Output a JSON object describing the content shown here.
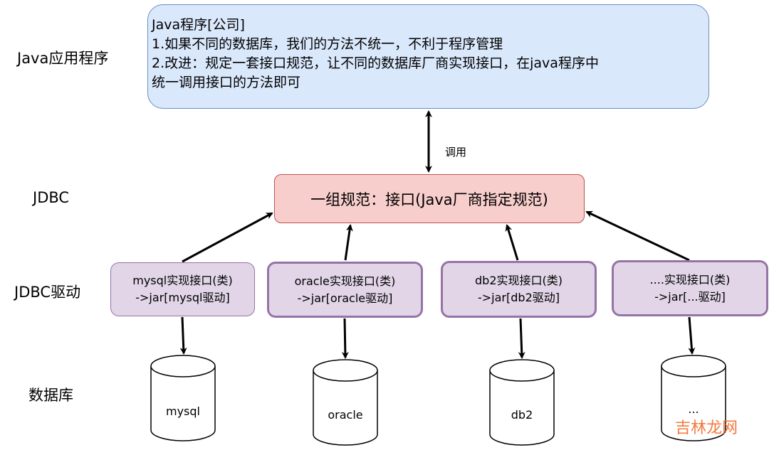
{
  "side_labels": {
    "app": "Java应用程序",
    "jdbc": "JDBC",
    "driver": "JDBC驱动",
    "db": "数据库"
  },
  "app_box": {
    "lines": [
      "Java程序[公司]",
      "1.如果不同的数据库，我们的方法不统一，不利于程序管理",
      "2.改进：规定一套接口规范，让不同的数据库厂商实现接口，在java程序中",
      "统一调用接口的方法即可"
    ]
  },
  "call_label": "调用",
  "jdbc_box": "一组规范：接口(Java厂商指定规范)",
  "drivers": [
    {
      "line1": "mysql实现接口(类)",
      "line2": "->jar[mysql驱动]"
    },
    {
      "line1": "oracle实现接口(类)",
      "line2": "->jar[oracle驱动]"
    },
    {
      "line1": "db2实现接口(类)",
      "line2": "->jar[db2驱动]"
    },
    {
      "line1": "....实现接口(类)",
      "line2": "->jar[...驱动]"
    }
  ],
  "databases": [
    "mysql",
    "oracle",
    "db2",
    "..."
  ],
  "watermark": "吉林龙网",
  "colors": {
    "app_fill": "#dae8fc",
    "app_stroke": "#6c8ebf",
    "jdbc_fill": "#f8cecc",
    "jdbc_stroke": "#b85450",
    "driver_fill": "#e1d5e7",
    "driver_stroke": "#9673a6",
    "watermark": "#f26b2a"
  }
}
